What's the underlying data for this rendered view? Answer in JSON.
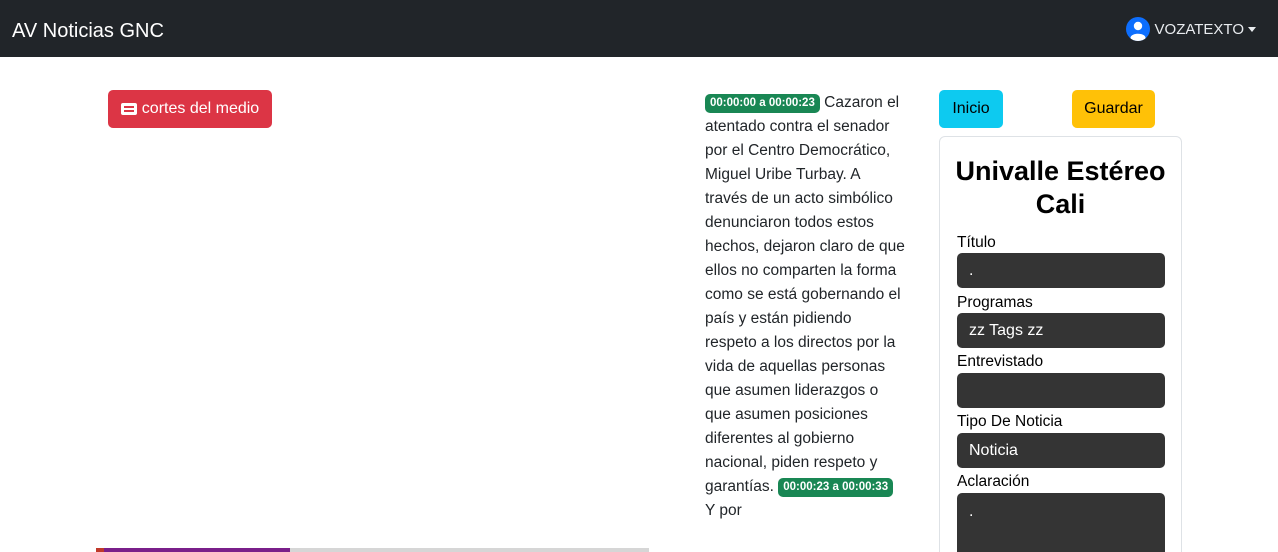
{
  "navbar": {
    "brand": "AV Noticias GNC",
    "user_name": "VOZATEXTO"
  },
  "media": {
    "cortes_label": "cortes del medio",
    "progress_fraction": 0.35
  },
  "transcript": {
    "segments": [
      {
        "time": "00:00:00 a 00:00:23",
        "text": "Cazaron el atentado contra el senador por el Centro Democrático, Miguel Uribe Turbay. A través de un acto simbólico denunciaron todos estos hechos, dejaron claro de que ellos no comparten la forma como se está gobernando el país y están pidiendo respeto a los directos por la vida de aquellas personas que asumen liderazgos o que asumen posiciones diferentes al gobierno nacional, piden respeto y garantías."
      },
      {
        "time": "00:00:23 a 00:00:33",
        "text": "Y por"
      }
    ]
  },
  "actions": {
    "inicio_label": "Inicio",
    "guardar_label": "Guardar"
  },
  "form": {
    "station_name": "Univalle Estéreo Cali",
    "titulo_label": "Título",
    "titulo_value": ".",
    "programas_label": "Programas",
    "programas_value": "zz Tags zz",
    "entrevistado_label": "Entrevistado",
    "entrevistado_value": "",
    "tipo_label": "Tipo De Noticia",
    "tipo_value": "Noticia",
    "aclaracion_label": "Aclaración",
    "aclaracion_value": "."
  }
}
